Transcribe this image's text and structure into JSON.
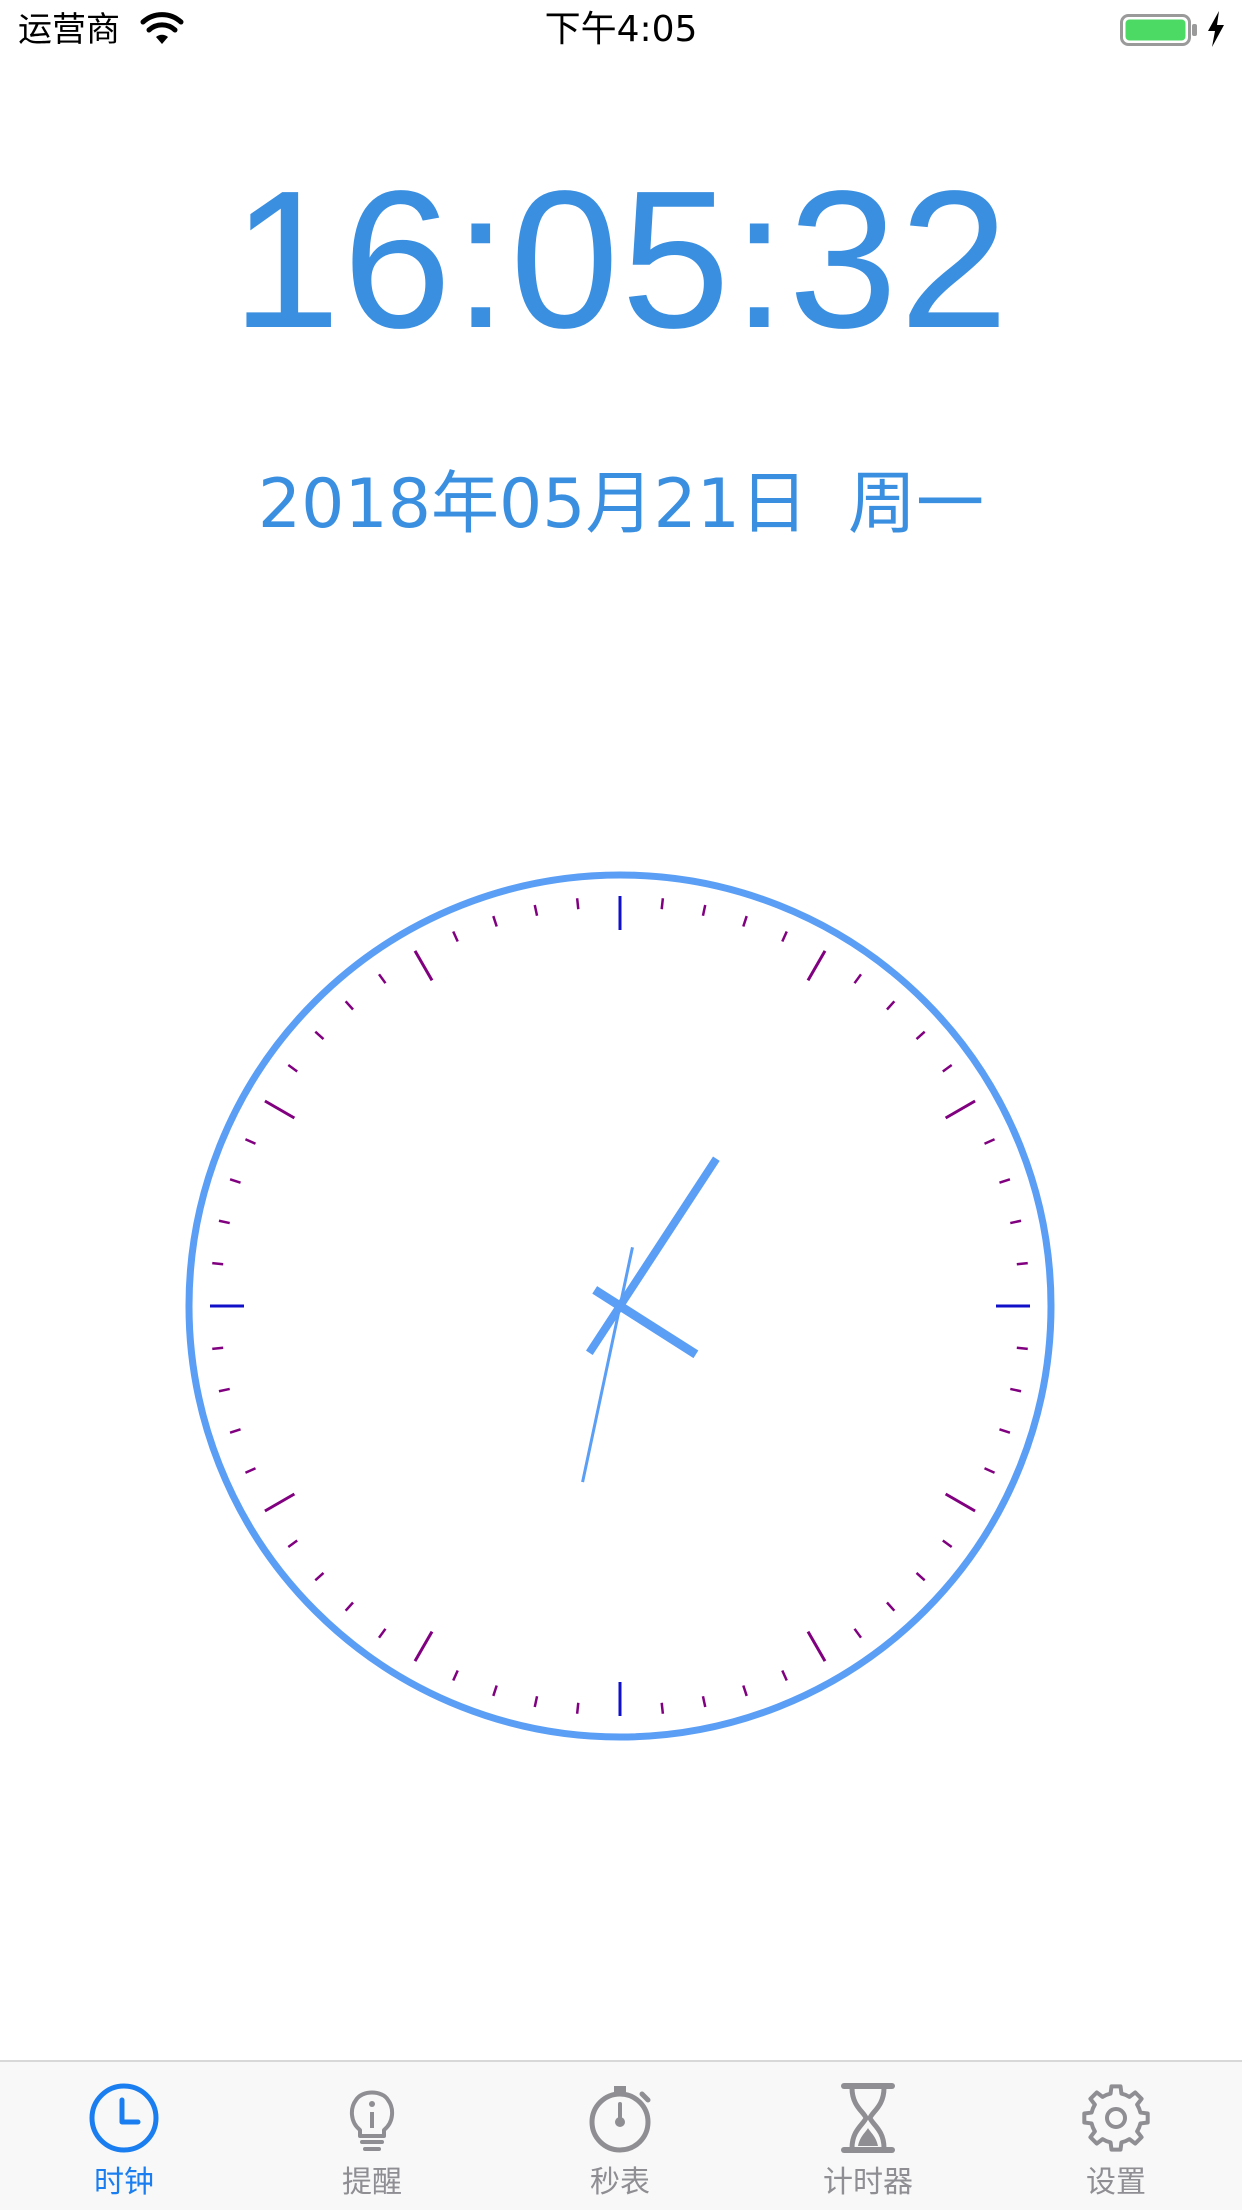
{
  "status_bar": {
    "carrier": "运营商",
    "time": "下午4:05",
    "battery_color": "#4cd964"
  },
  "clock": {
    "digital_time": "16:05:32",
    "date": "2018年05月21日",
    "weekday": "周一",
    "hour": 16,
    "minute": 5,
    "second": 32,
    "colors": {
      "text": "#3a8fe0",
      "face_ring": "#5a9ef5",
      "hands": "#5a9ef5",
      "major_tick": "#1010c8",
      "hour_tick": "#800080",
      "minute_tick": "#800080"
    }
  },
  "tabbar": {
    "active_color": "#1a7ef0",
    "inactive_color": "#8e8e93",
    "tabs": [
      {
        "label": "时钟",
        "icon": "clock-icon",
        "active": true
      },
      {
        "label": "提醒",
        "icon": "lightbulb-icon",
        "active": false
      },
      {
        "label": "秒表",
        "icon": "stopwatch-icon",
        "active": false
      },
      {
        "label": "计时器",
        "icon": "hourglass-icon",
        "active": false
      },
      {
        "label": "设置",
        "icon": "gear-icon",
        "active": false
      }
    ]
  }
}
